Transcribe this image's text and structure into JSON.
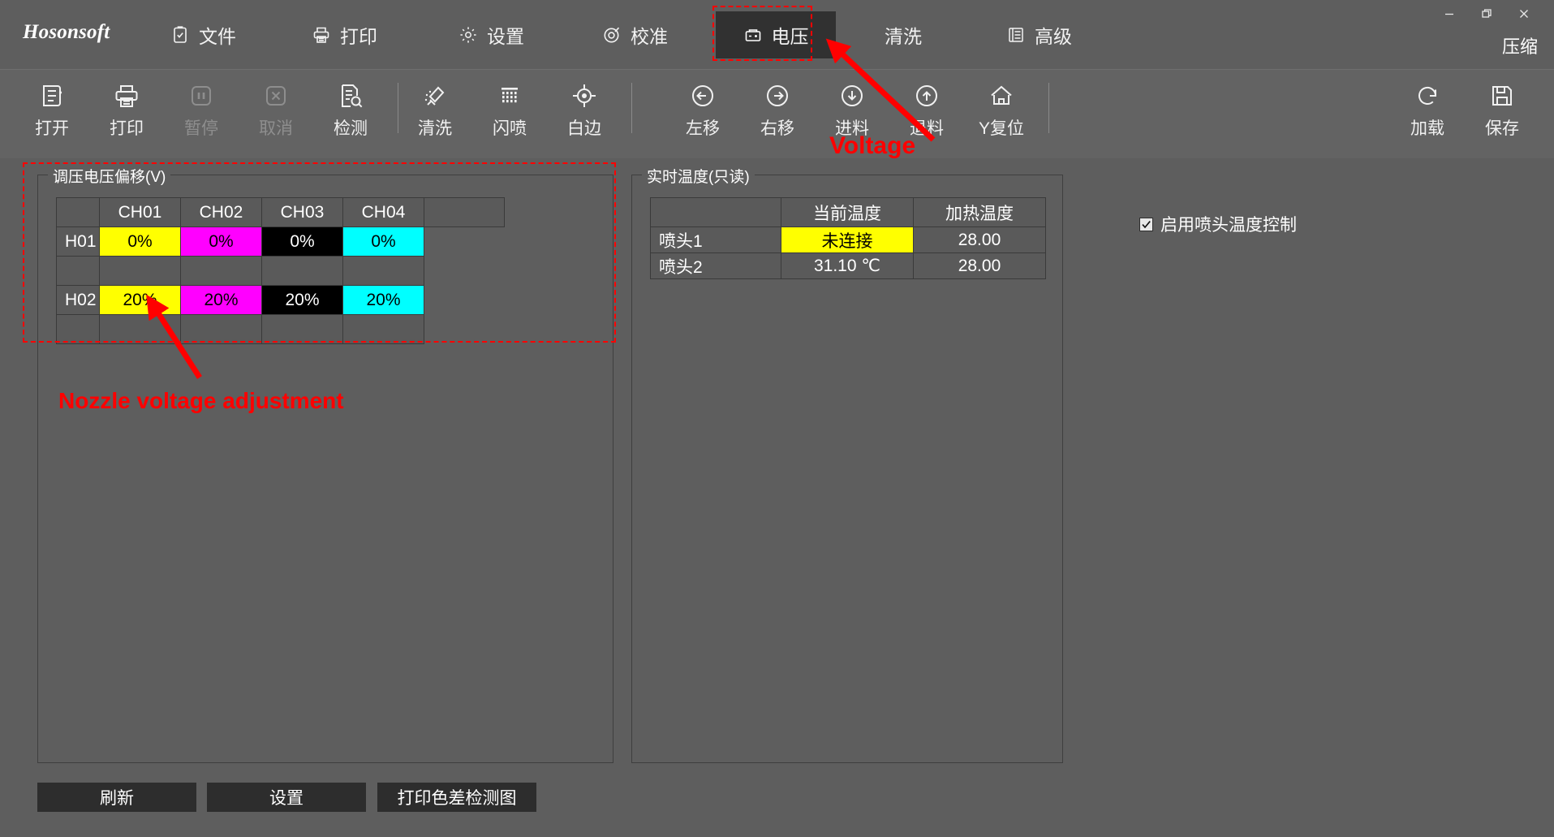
{
  "window": {
    "app_name": "Hosonsoft",
    "compress_label": "压缩",
    "controls": [
      {
        "name": "minimize",
        "glyph": "minimize-icon"
      },
      {
        "name": "maximize",
        "glyph": "restore-icon"
      },
      {
        "name": "close",
        "glyph": "close-icon"
      }
    ]
  },
  "menu": {
    "items": [
      {
        "label": "文件",
        "icon": "clipboard-check-icon",
        "active": false
      },
      {
        "label": "打印",
        "icon": "printer-icon",
        "active": false
      },
      {
        "label": "设置",
        "icon": "gear-icon",
        "active": false
      },
      {
        "label": "校准",
        "icon": "target-icon",
        "active": false
      },
      {
        "label": "电压",
        "icon": "battery-icon",
        "active": true
      },
      {
        "label": "清洗",
        "icon": "none",
        "active": false
      },
      {
        "label": "高级",
        "icon": "list-icon",
        "active": false
      }
    ]
  },
  "toolbar": {
    "groups": [
      {
        "buttons": [
          {
            "label": "打开",
            "icon": "file-open-icon",
            "disabled": false
          },
          {
            "label": "打印",
            "icon": "printer-icon",
            "disabled": false
          },
          {
            "label": "暂停",
            "icon": "pause-icon",
            "disabled": true
          },
          {
            "label": "取消",
            "icon": "cancel-icon",
            "disabled": true
          },
          {
            "label": "检测",
            "icon": "document-search-icon",
            "disabled": false
          }
        ]
      },
      {
        "buttons": [
          {
            "label": "清洗",
            "icon": "brush-icon",
            "disabled": false
          },
          {
            "label": "闪喷",
            "icon": "grid-spray-icon",
            "disabled": false
          },
          {
            "label": "白边",
            "icon": "crosshair-icon",
            "disabled": false
          }
        ]
      },
      {
        "buttons": [
          {
            "label": "左移",
            "icon": "arrow-left-circle-icon",
            "disabled": false
          },
          {
            "label": "右移",
            "icon": "arrow-right-circle-icon",
            "disabled": false
          },
          {
            "label": "进料",
            "icon": "arrow-down-circle-icon",
            "disabled": false
          },
          {
            "label": "退料",
            "icon": "arrow-up-circle-icon",
            "disabled": false
          },
          {
            "label": "Y复位",
            "icon": "home-icon",
            "disabled": false
          }
        ]
      },
      {
        "buttons": [
          {
            "label": "加载",
            "icon": "reload-icon",
            "disabled": false
          },
          {
            "label": "保存",
            "icon": "save-icon",
            "disabled": false
          }
        ]
      }
    ]
  },
  "voltage_panel": {
    "title": "调压电压偏移(V)",
    "table": {
      "headers": [
        "",
        "CH01",
        "CH02",
        "CH03",
        "CH04",
        ""
      ],
      "rows": [
        {
          "label": "H01",
          "cells": [
            {
              "value": "0%",
              "bg": "#ffff00",
              "fg": "#000000"
            },
            {
              "value": "0%",
              "bg": "#ff00ff",
              "fg": "#000000"
            },
            {
              "value": "0%",
              "bg": "#000000",
              "fg": "#ffffff"
            },
            {
              "value": "0%",
              "bg": "#00ffff",
              "fg": "#000000"
            }
          ]
        },
        {
          "label": "",
          "cells": [
            {
              "value": "",
              "bg": "#5a5a5a",
              "fg": "#ffffff"
            },
            {
              "value": "",
              "bg": "#5a5a5a",
              "fg": "#ffffff"
            },
            {
              "value": "",
              "bg": "#5a5a5a",
              "fg": "#ffffff"
            },
            {
              "value": "",
              "bg": "#5a5a5a",
              "fg": "#ffffff"
            }
          ]
        },
        {
          "label": "H02",
          "cells": [
            {
              "value": "20%",
              "bg": "#ffff00",
              "fg": "#000000"
            },
            {
              "value": "20%",
              "bg": "#ff00ff",
              "fg": "#000000"
            },
            {
              "value": "20%",
              "bg": "#000000",
              "fg": "#ffffff"
            },
            {
              "value": "20%",
              "bg": "#00ffff",
              "fg": "#000000"
            }
          ]
        },
        {
          "label": "",
          "cells": [
            {
              "value": "",
              "bg": "#5a5a5a",
              "fg": "#ffffff"
            },
            {
              "value": "",
              "bg": "#5a5a5a",
              "fg": "#ffffff"
            },
            {
              "value": "",
              "bg": "#5a5a5a",
              "fg": "#ffffff"
            },
            {
              "value": "",
              "bg": "#5a5a5a",
              "fg": "#ffffff"
            }
          ]
        }
      ]
    }
  },
  "temperature_panel": {
    "title": "实时温度(只读)",
    "table": {
      "headers": [
        "",
        "当前温度",
        "加热温度"
      ],
      "rows": [
        {
          "label": "喷头1",
          "cells": [
            {
              "value": "未连接",
              "bg": "#ffff00",
              "fg": "#000000"
            },
            {
              "value": "28.00",
              "bg": "#5a5a5a",
              "fg": "#ffffff"
            }
          ]
        },
        {
          "label": "喷头2",
          "cells": [
            {
              "value": "31.10 ℃",
              "bg": "#5a5a5a",
              "fg": "#ffffff"
            },
            {
              "value": "28.00",
              "bg": "#5a5a5a",
              "fg": "#ffffff"
            }
          ]
        }
      ]
    }
  },
  "options": {
    "enable_nozzle_temp_control": {
      "label": "启用喷头温度控制",
      "checked": true
    }
  },
  "footer": {
    "buttons": [
      {
        "label": "刷新"
      },
      {
        "label": "设置"
      },
      {
        "label": "打印色差检测图"
      }
    ]
  },
  "annotations": {
    "voltage_label": "Voltage",
    "nozzle_label": "Nozzle voltage adjustment",
    "color": "#ff0000"
  }
}
